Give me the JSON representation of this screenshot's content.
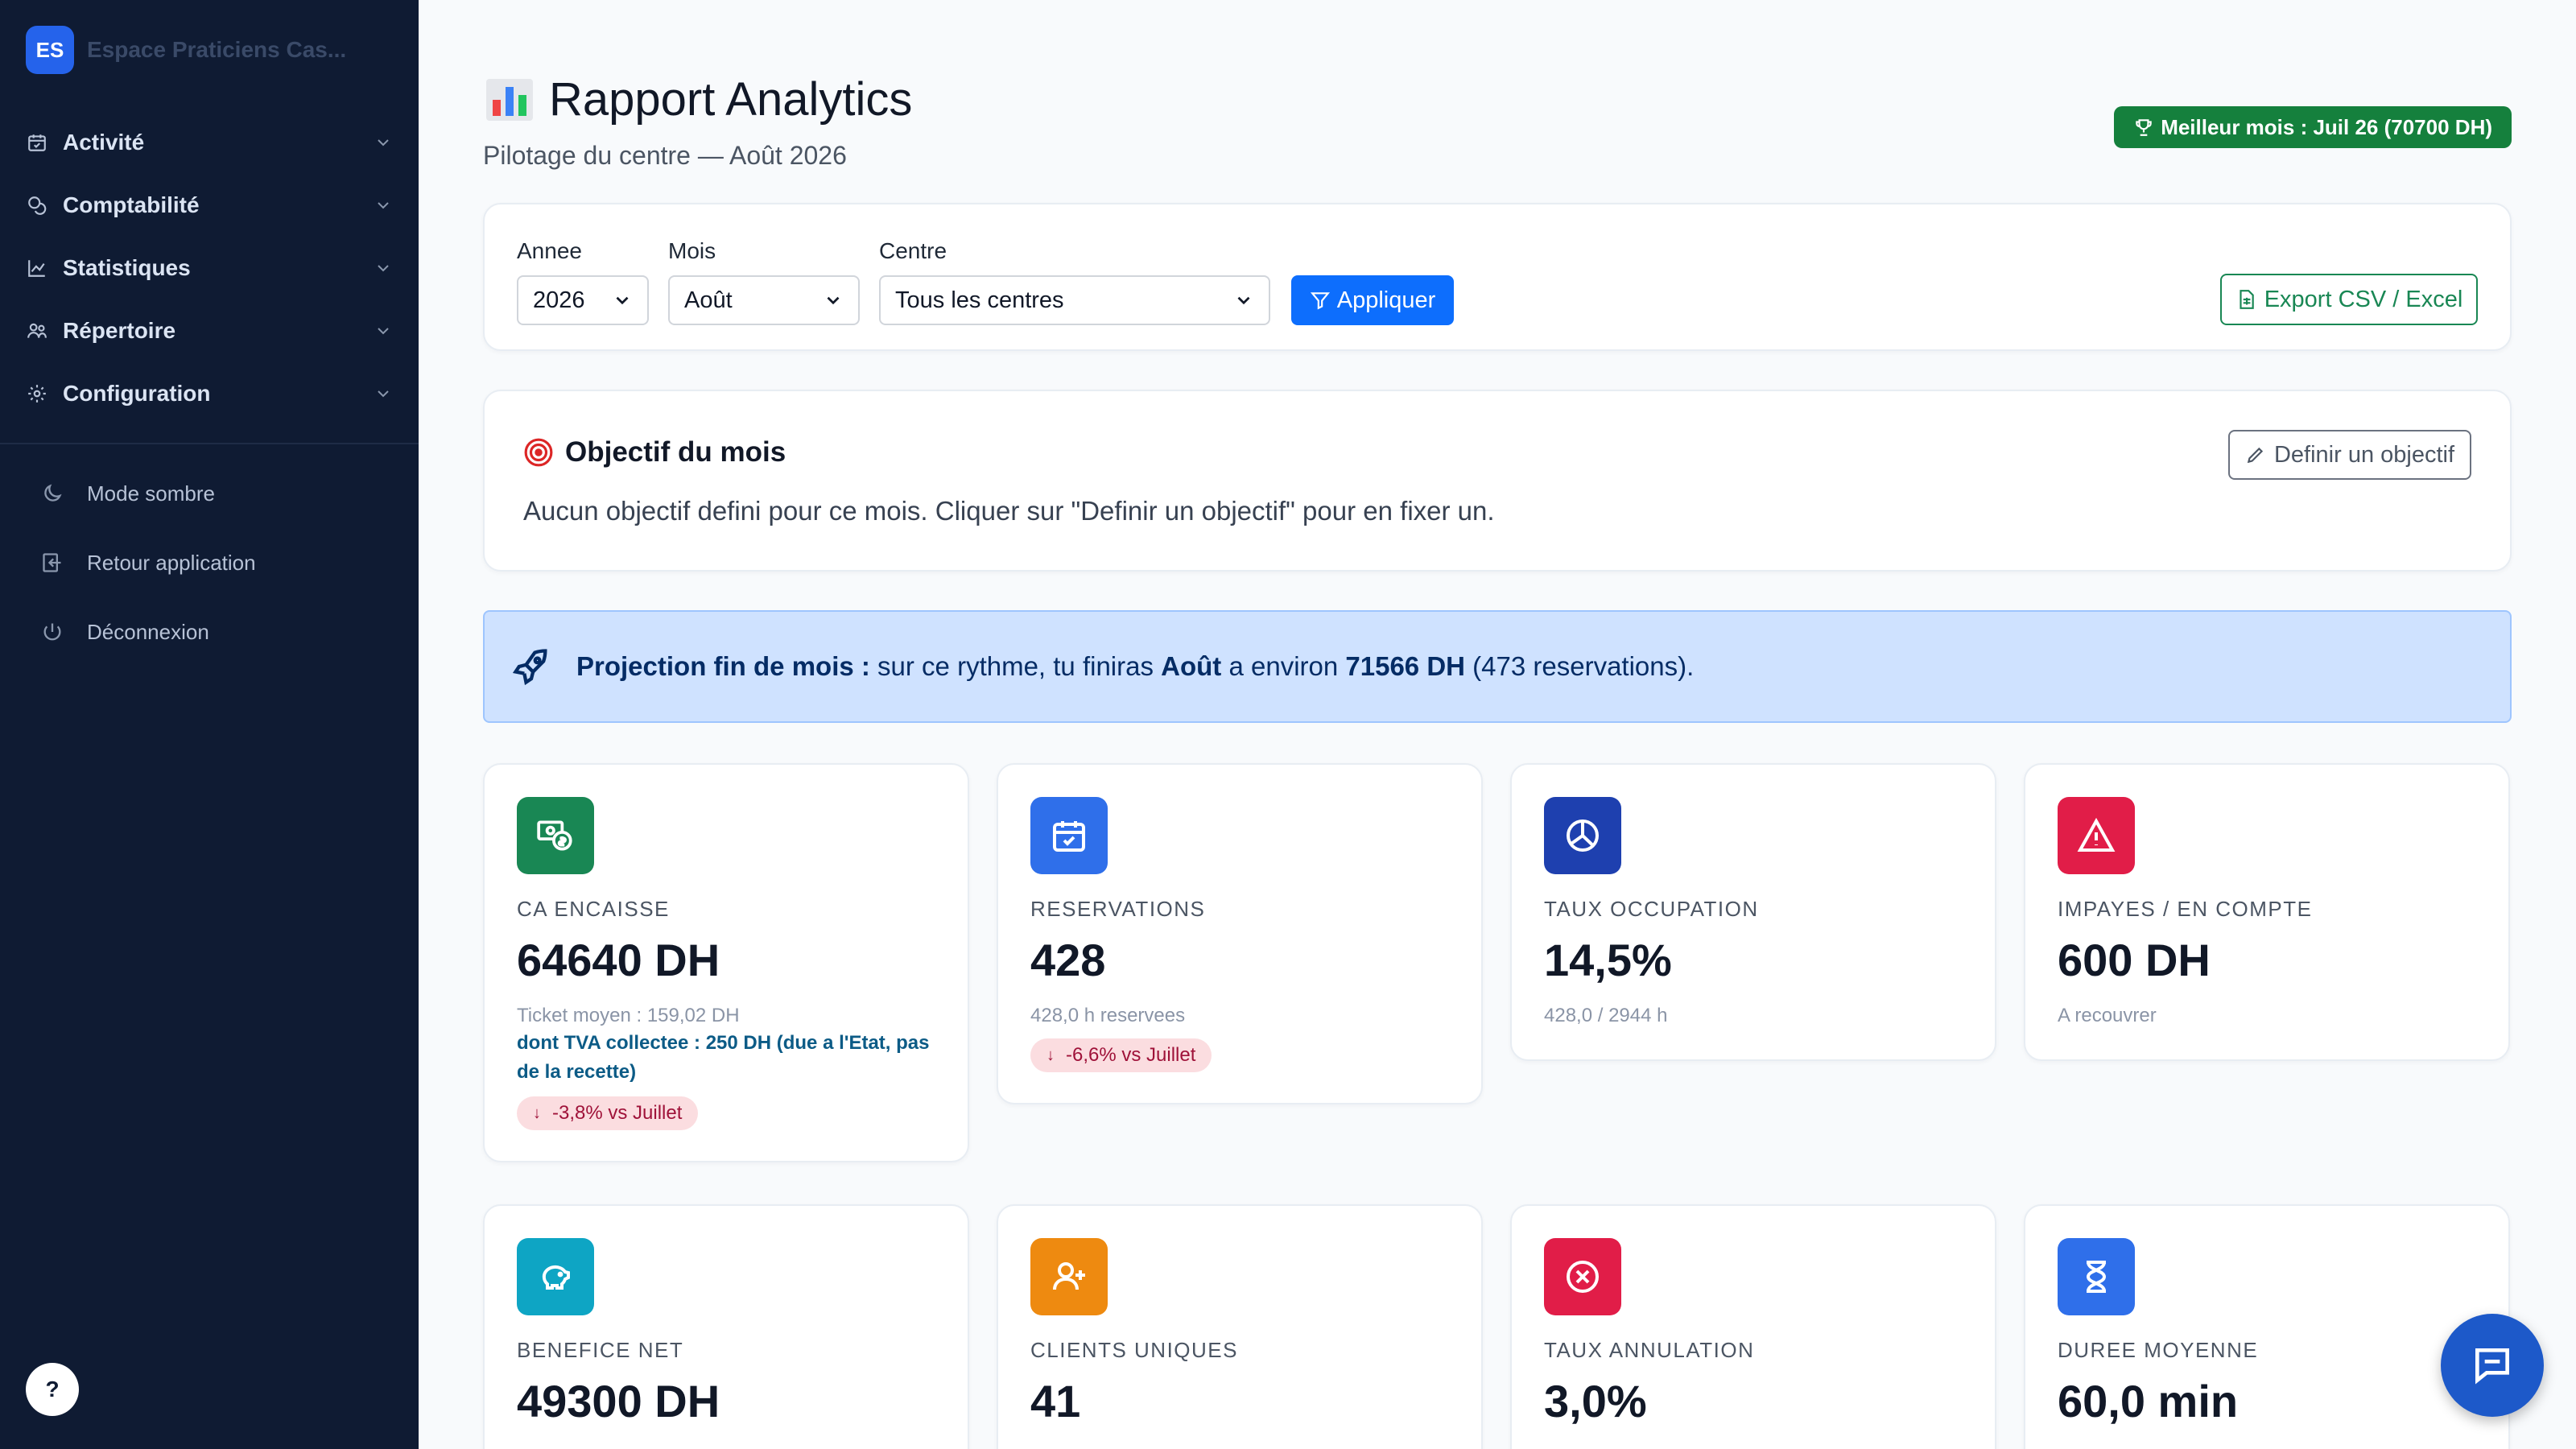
{
  "sidebar": {
    "brand_initials": "ES",
    "brand_name": "Espace Praticiens Cas...",
    "items": [
      {
        "label": "Activité",
        "icon": "calendar-check-icon"
      },
      {
        "label": "Comptabilité",
        "icon": "coins-icon"
      },
      {
        "label": "Statistiques",
        "icon": "chart-line-icon"
      },
      {
        "label": "Répertoire",
        "icon": "people-icon"
      },
      {
        "label": "Configuration",
        "icon": "gear-icon"
      }
    ],
    "links": [
      {
        "label": "Mode sombre",
        "icon": "moon-icon"
      },
      {
        "label": "Retour application",
        "icon": "back-icon"
      },
      {
        "label": "Déconnexion",
        "icon": "power-icon"
      }
    ],
    "help": "?"
  },
  "header": {
    "title": "Rapport Analytics",
    "subtitle": "Pilotage du centre — Août 2026",
    "best_month": "Meilleur mois : Juil 26 (70700 DH)"
  },
  "filters": {
    "year_label": "Annee",
    "year_value": "2026",
    "month_label": "Mois",
    "month_value": "Août",
    "center_label": "Centre",
    "center_value": "Tous les centres",
    "apply": "Appliquer",
    "export": "Export CSV / Excel"
  },
  "objective": {
    "title": "Objectif du mois",
    "text": "Aucun objectif defini pour ce mois. Cliquer sur \"Definir un objectif\" pour en fixer un.",
    "button": "Definir un objectif"
  },
  "projection": {
    "lead": "Projection fin de mois :",
    "text1": " sur ce rythme, tu finiras ",
    "month": "Août",
    "text2": " a environ ",
    "amount": "71566 DH",
    "text3": " (473 reservations)."
  },
  "kpis": [
    {
      "label": "CA ENCAISSE",
      "value": "64640 DH",
      "sub": "Ticket moyen : 159,02 DH",
      "note": "dont TVA collectee : 250 DH (due a l'Etat, pas de la recette)",
      "delta": "-3,8% vs Juillet",
      "color": "#198754",
      "icon": "money-icon"
    },
    {
      "label": "RESERVATIONS",
      "value": "428",
      "sub": "428,0 h reservees",
      "delta": "-6,6% vs Juillet",
      "color": "#2f6fea",
      "icon": "calendar-check-icon"
    },
    {
      "label": "TAUX OCCUPATION",
      "value": "14,5%",
      "sub": "428,0 / 2944 h",
      "color": "#1e40af",
      "icon": "pie-chart-icon"
    },
    {
      "label": "IMPAYES / EN COMPTE",
      "value": "600 DH",
      "sub": "A recouvrer",
      "color": "#e11d48",
      "icon": "warning-icon"
    },
    {
      "label": "BENEFICE NET",
      "value": "49300 DH",
      "color": "#0ea5c4",
      "icon": "piggy-bank-icon"
    },
    {
      "label": "CLIENTS UNIQUES",
      "value": "41",
      "color": "#ee8a10",
      "icon": "person-add-icon"
    },
    {
      "label": "TAUX ANNULATION",
      "value": "3,0%",
      "color": "#e11d48",
      "icon": "x-circle-icon"
    },
    {
      "label": "DUREE MOYENNE",
      "value": "60,0 min",
      "color": "#2f6fea",
      "icon": "hourglass-icon"
    }
  ]
}
